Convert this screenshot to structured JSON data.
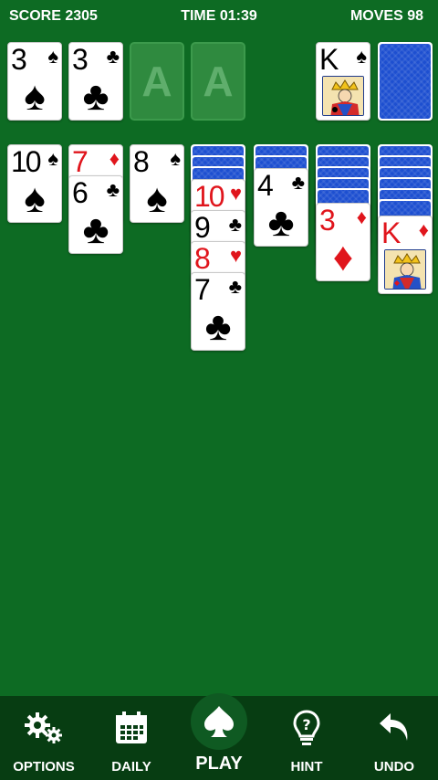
{
  "header": {
    "score": "SCORE 2305",
    "time": "TIME 01:39",
    "moves": "MOVES 98"
  },
  "cards": {
    "foundation_3_spades": {
      "rank": "3",
      "suit": "♠"
    },
    "foundation_3_clubs": {
      "rank": "3",
      "suit": "♣"
    },
    "foundation_empty_1": "A",
    "foundation_empty_2": "A",
    "waste_king_spades": {
      "rank": "K",
      "suit": "♠"
    },
    "col1_10_spades": {
      "rank": "10",
      "suit": "♠"
    },
    "col2_7_diamonds": {
      "rank": "7",
      "suit": "♦"
    },
    "col2_6_clubs": {
      "rank": "6",
      "suit": "♣"
    },
    "col3_8_spades": {
      "rank": "8",
      "suit": "♠"
    },
    "col4_10_hearts": {
      "rank": "10",
      "suit": "♥"
    },
    "col4_9_clubs": {
      "rank": "9",
      "suit": "♣"
    },
    "col4_8_hearts": {
      "rank": "8",
      "suit": "♥"
    },
    "col4_7_clubs": {
      "rank": "7",
      "suit": "♣"
    },
    "col5_4_clubs": {
      "rank": "4",
      "suit": "♣"
    },
    "col6_3_diamonds": {
      "rank": "3",
      "suit": "♦"
    },
    "col7_king_diamonds": {
      "rank": "K",
      "suit": "♦"
    }
  },
  "toolbar": {
    "options": "OPTIONS",
    "daily": "DAILY",
    "play": "PLAY",
    "hint": "HINT",
    "undo": "UNDO"
  },
  "icons": {
    "options": "gear-icon",
    "daily": "calendar-icon",
    "play": "spade-icon",
    "hint": "lightbulb-question-icon",
    "undo": "undo-arrow-icon"
  },
  "colors": {
    "felt": "#0d6b23",
    "toolbar": "#073d12",
    "card_back": "#1d4fd0",
    "red_suit": "#e0151c"
  }
}
